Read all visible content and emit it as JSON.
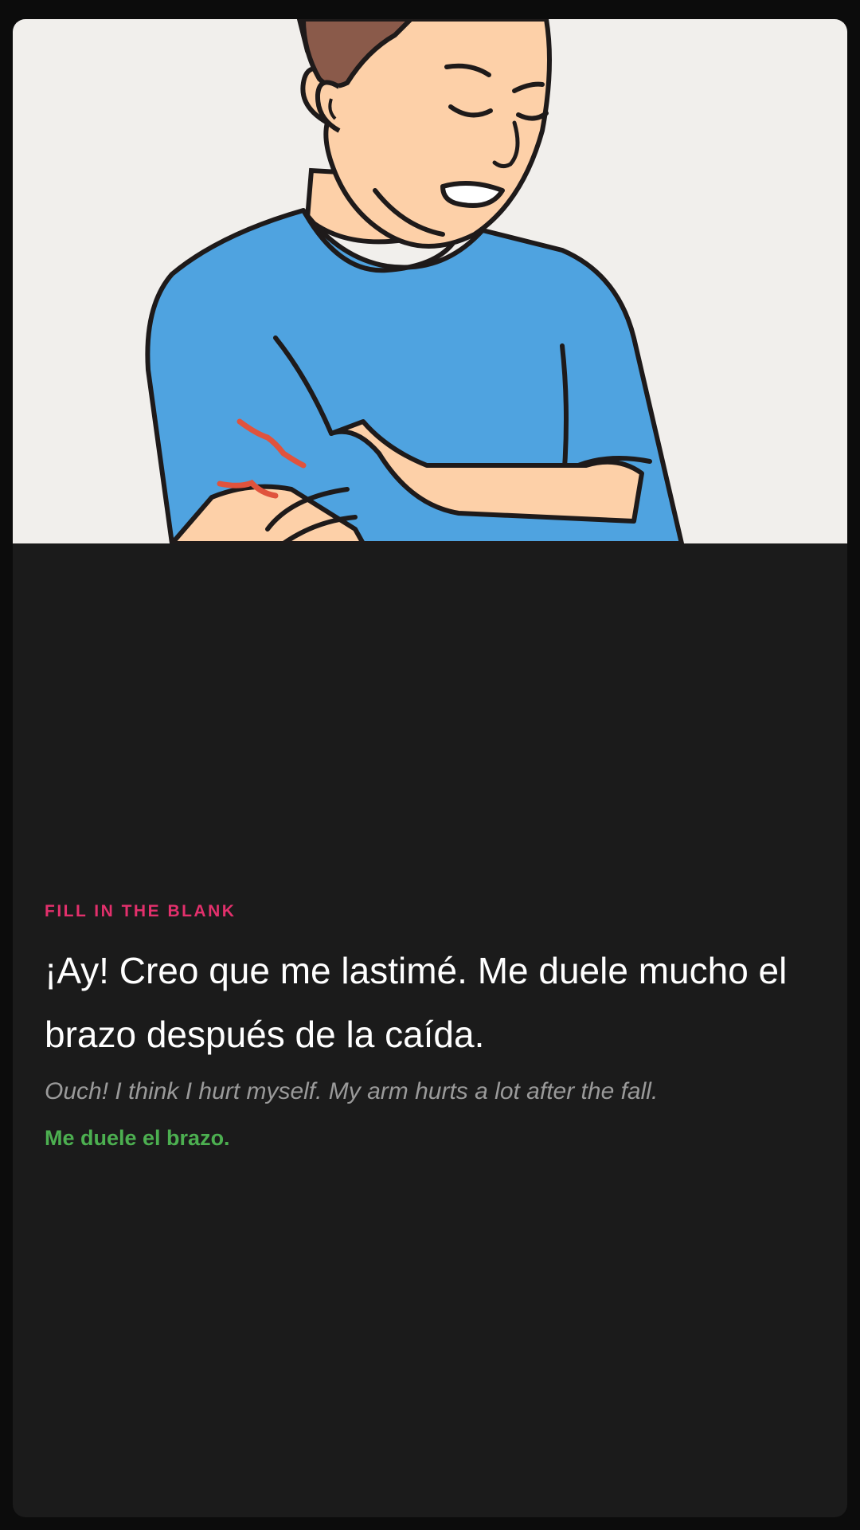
{
  "card": {
    "image_alt": "man-holding-hurt-arm",
    "label": "FILL IN THE BLANK",
    "sentence": "¡Ay! Creo que me lastimé. Me duele mucho el brazo después de la caída.",
    "translation": "Ouch! I think I hurt myself. My arm hurts a lot after the fall.",
    "answer": "Me duele el brazo."
  },
  "colors": {
    "background": "#0c0c0c",
    "card": "#1b1b1b",
    "label": "#e3306c",
    "sentence": "#ffffff",
    "translation": "#9a9a9a",
    "answer": "#4caf50",
    "illustration_bg": "#f1efec",
    "shirt": "#4fa3e0",
    "skin": "#fdd0a8",
    "hair": "#8a5a4a",
    "pain_marks": "#e0533d"
  }
}
